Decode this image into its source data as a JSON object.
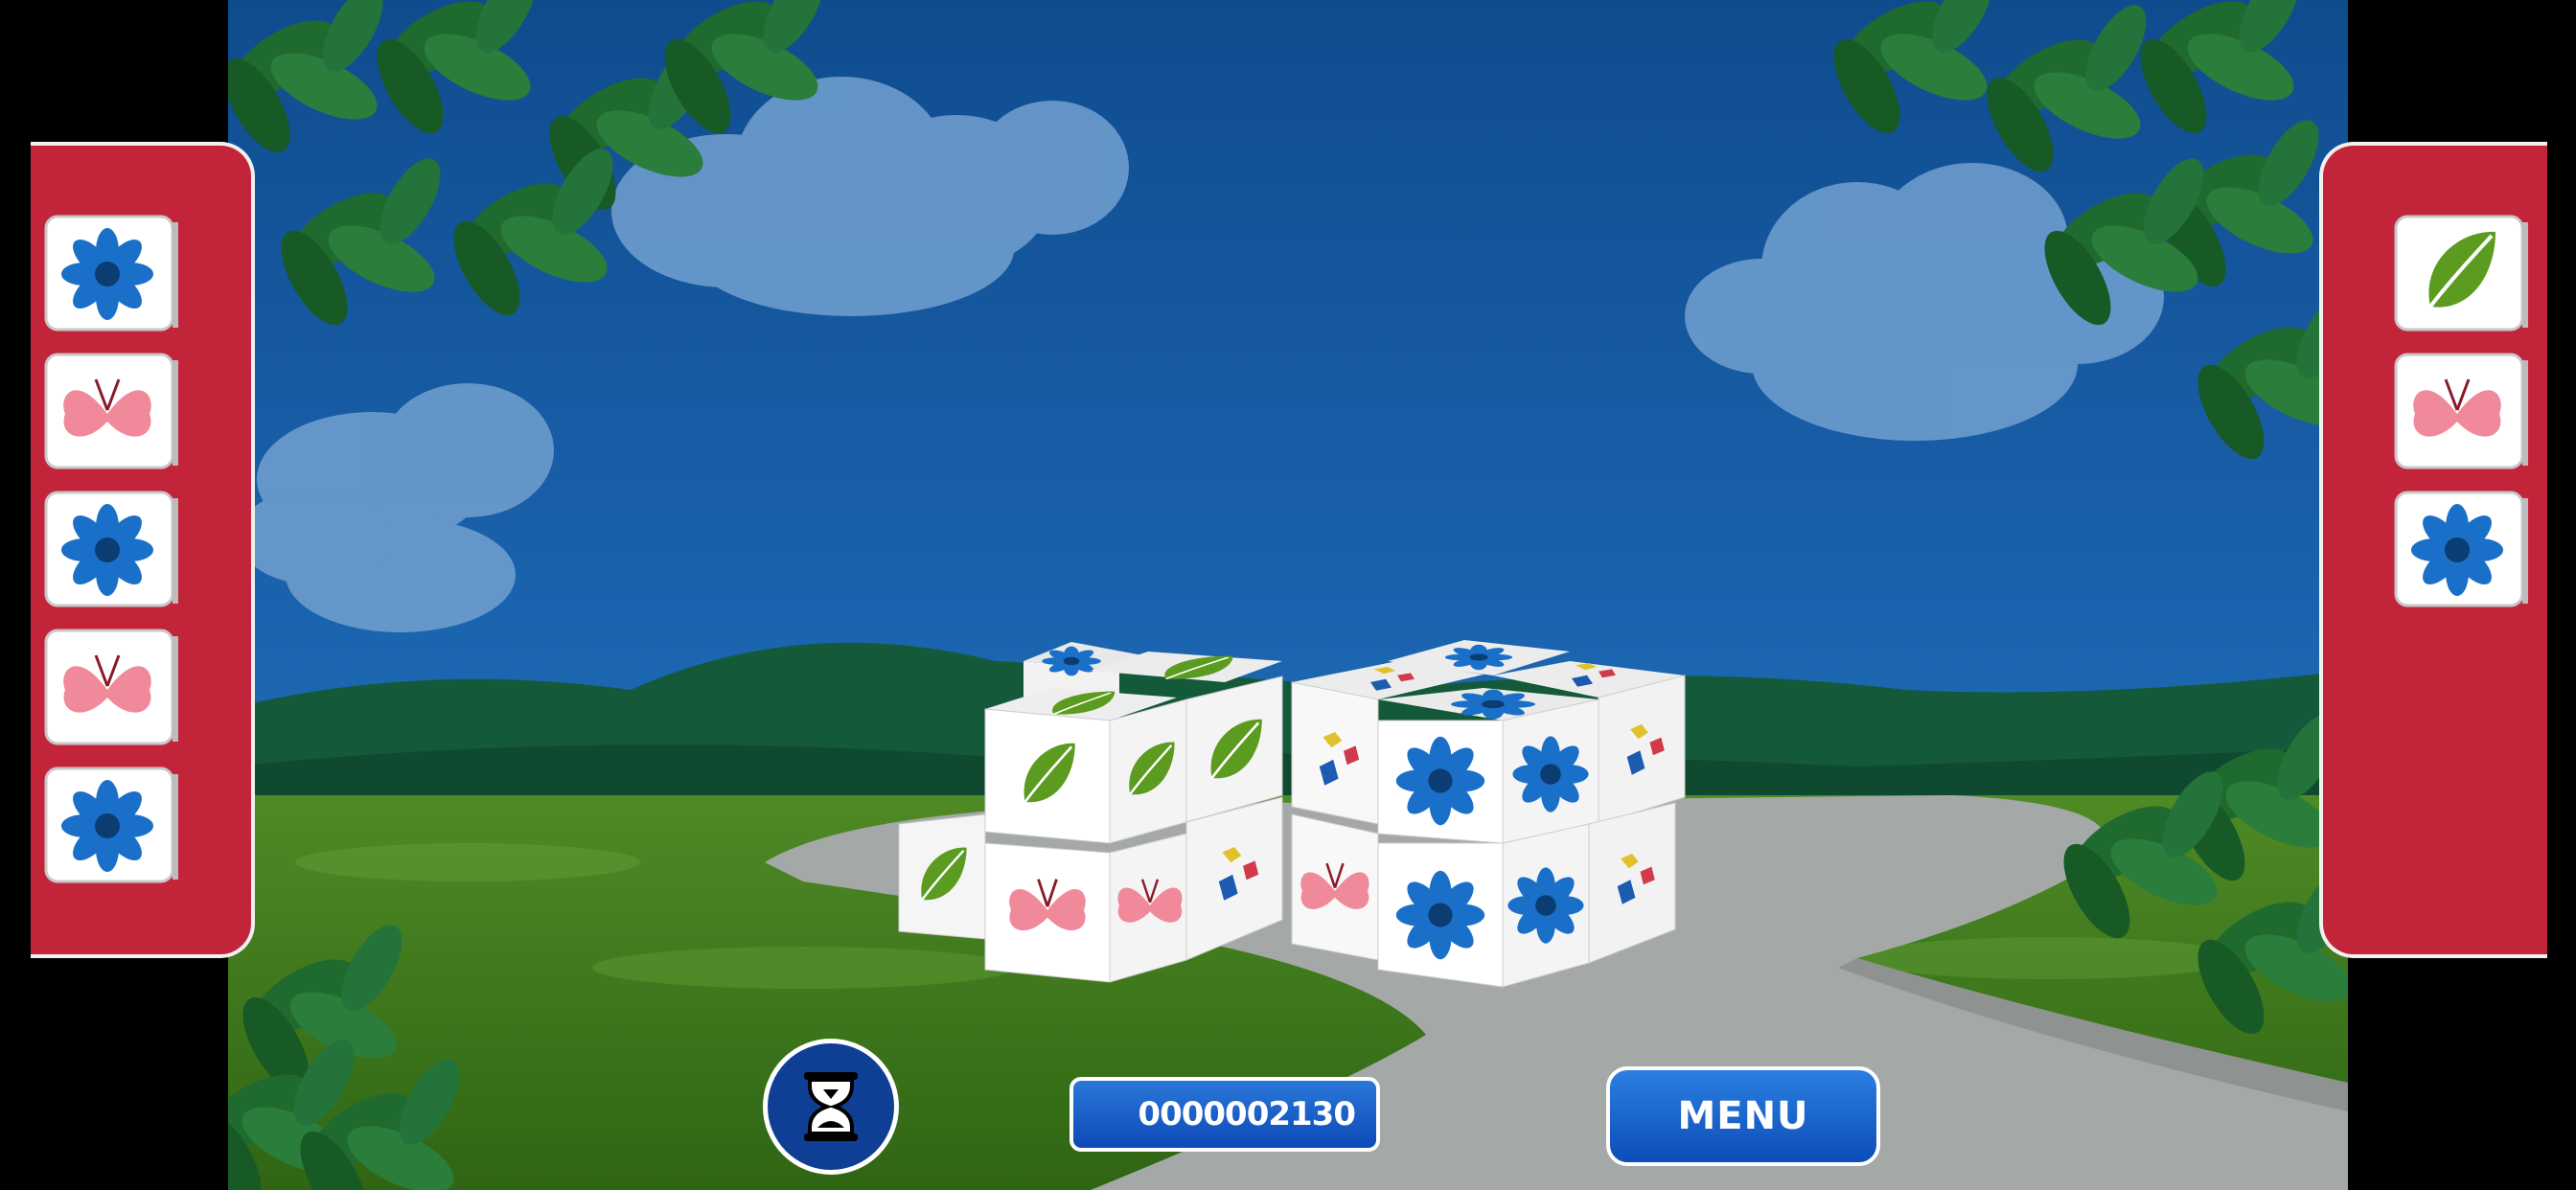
{
  "hud": {
    "score": "0000002130",
    "menu_label": "MENU",
    "timer_icon": "hourglass-icon"
  },
  "left_tray": {
    "tiles": [
      "flower",
      "butterfly",
      "flower",
      "butterfly",
      "flower"
    ]
  },
  "right_tray": {
    "tiles": [
      "leaf",
      "butterfly",
      "flower"
    ]
  },
  "colors": {
    "sky": "#1a5ea3",
    "panel_red": "#c2253a",
    "button_blue": "#1b63cf",
    "grass": "#3f7a1c"
  }
}
